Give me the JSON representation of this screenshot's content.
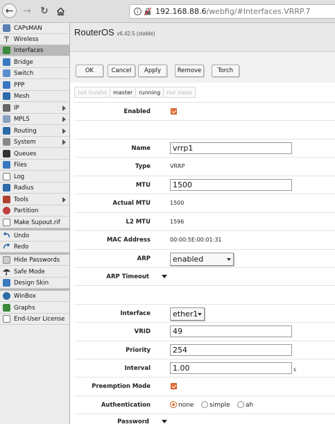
{
  "browser": {
    "url_host": "192.168.88.6",
    "url_path": "/webfig/#Interfaces.VRRP.7"
  },
  "sidebar": {
    "items": [
      {
        "label": "CAPsMAN",
        "icon": "capsman-icon",
        "color": "#5a7fb0"
      },
      {
        "label": "Wireless",
        "icon": "wireless-icon",
        "color": "#4a4a4a"
      },
      {
        "label": "Interfaces",
        "icon": "interfaces-icon",
        "color": "#3c8a3c"
      },
      {
        "label": "Bridge",
        "icon": "bridge-icon",
        "color": "#3a78c0"
      },
      {
        "label": "Switch",
        "icon": "switch-icon",
        "color": "#5a8fcf"
      },
      {
        "label": "PPP",
        "icon": "ppp-icon",
        "color": "#3a78c0"
      },
      {
        "label": "Mesh",
        "icon": "mesh-icon",
        "color": "#2d6aa8"
      },
      {
        "label": "IP",
        "icon": "ip-icon",
        "color": "#555555"
      },
      {
        "label": "MPLS",
        "icon": "mpls-icon",
        "color": "#8aa0c0"
      },
      {
        "label": "Routing",
        "icon": "routing-icon",
        "color": "#2d6aa8"
      },
      {
        "label": "System",
        "icon": "system-icon",
        "color": "#777777"
      },
      {
        "label": "Queues",
        "icon": "queues-icon",
        "color": "#333333"
      },
      {
        "label": "Files",
        "icon": "files-icon",
        "color": "#3a78c0"
      },
      {
        "label": "Log",
        "icon": "log-icon",
        "color": "#ffffff"
      },
      {
        "label": "Radius",
        "icon": "radius-icon",
        "color": "#2d6aa8"
      },
      {
        "label": "Tools",
        "icon": "tools-icon",
        "color": "#b04030"
      },
      {
        "label": "Partition",
        "icon": "partition-icon",
        "color": "#c04040"
      },
      {
        "label": "Make Supout.rif",
        "icon": "supout-icon",
        "color": "#ffffff"
      },
      {
        "label": "Undo",
        "icon": "undo-icon",
        "color": "#2d6aa8"
      },
      {
        "label": "Redo",
        "icon": "redo-icon",
        "color": "#2d6aa8"
      },
      {
        "label": "Hide Passwords",
        "icon": "hide-passwords-icon",
        "color": "#cccccc"
      },
      {
        "label": "Safe Mode",
        "icon": "safe-mode-icon",
        "color": "#333333"
      },
      {
        "label": "Design Skin",
        "icon": "design-skin-icon",
        "color": "#3a78c0"
      },
      {
        "label": "WinBox",
        "icon": "winbox-icon",
        "color": "#2d6aa8"
      },
      {
        "label": "Graphs",
        "icon": "graphs-icon",
        "color": "#3c8a3c"
      },
      {
        "label": "End-User License",
        "icon": "license-icon",
        "color": "#ffffff"
      }
    ]
  },
  "header": {
    "title": "RouterOS",
    "version": "v6.42.5 (stable)"
  },
  "toolbar": {
    "ok": "OK",
    "cancel": "Cancel",
    "apply": "Apply",
    "remove": "Remove",
    "torch": "Torch"
  },
  "flags": [
    "not invalid",
    "master",
    "running",
    "not slave"
  ],
  "form": {
    "enabled_label": "Enabled",
    "name_label": "Name",
    "name_value": "vrrp1",
    "type_label": "Type",
    "type_value": "VRRP",
    "mtu_label": "MTU",
    "mtu_value": "1500",
    "actual_mtu_label": "Actual MTU",
    "actual_mtu_value": "1500",
    "l2mtu_label": "L2 MTU",
    "l2mtu_value": "1596",
    "mac_label": "MAC Address",
    "mac_value": "00:00:5E:00:01:31",
    "arp_label": "ARP",
    "arp_value": "enabled",
    "arp_timeout_label": "ARP Timeout",
    "interface_label": "Interface",
    "interface_value": "ether1",
    "vrid_label": "VRID",
    "vrid_value": "49",
    "priority_label": "Priority",
    "priority_value": "254",
    "interval_label": "Interval",
    "interval_value": "1.00",
    "interval_unit": "s",
    "preemption_label": "Preemption Mode",
    "auth_label": "Authentication",
    "auth_none": "none",
    "auth_simple": "simple",
    "auth_ah": "ah",
    "password_label": "Password"
  },
  "colors": {
    "accent": "#e4703a"
  }
}
